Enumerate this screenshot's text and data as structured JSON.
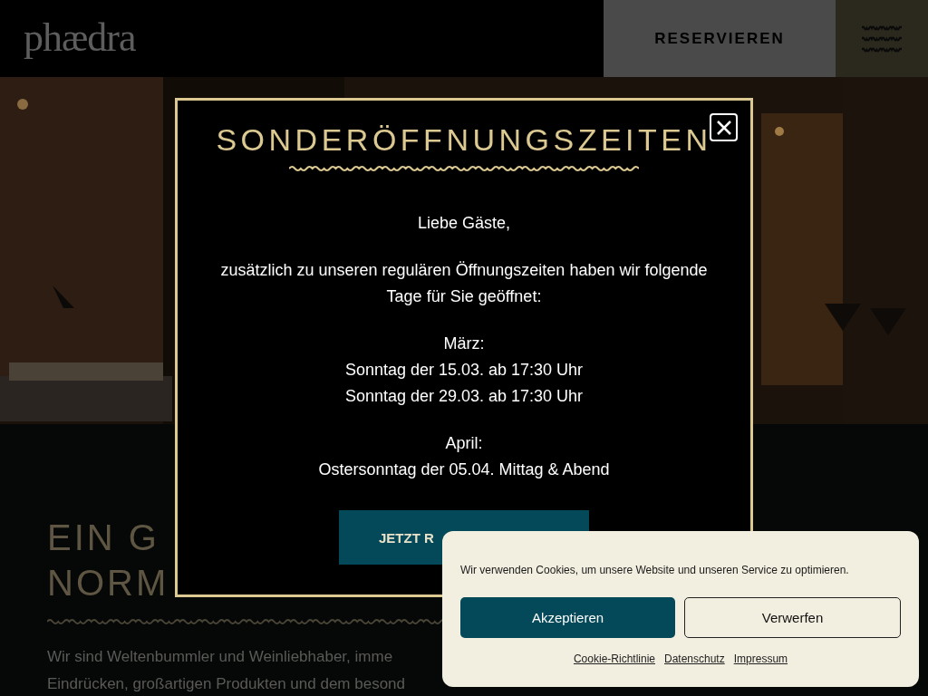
{
  "header": {
    "logo": "phædra",
    "reserve_button": "RESERVIEREN"
  },
  "intro": {
    "heading_lines": [
      "EIN G",
      "NORM"
    ],
    "paragraph_lines": [
      "Wir sind Weltenbummler und Weinliebhaber, imme",
      "Eindrücken, großartigen Produkten und dem besond"
    ]
  },
  "modal": {
    "title": "SONDERÖFFNUNGSZEITEN",
    "paragraphs": [
      [
        "Liebe Gäste,"
      ],
      [
        "zusätzlich zu unseren regulären Öffnungszeiten haben wir folgende Tage für Sie geöffnet:"
      ],
      [
        "März:",
        "Sonntag der 15.03. ab 17:30 Uhr",
        "Sonntag der 29.03. ab 17:30 Uhr"
      ],
      [
        "April:",
        "Ostersonntag der 05.04. Mittag & Abend"
      ]
    ],
    "button": "JETZT R"
  },
  "cookie_banner": {
    "message": "Wir verwenden Cookies, um unsere Website und unseren Service zu optimieren.",
    "buttons": [
      {
        "label": "Akzeptieren",
        "kind": "primary"
      },
      {
        "label": "Verwerfen",
        "kind": "secondary"
      }
    ],
    "links": [
      "Cookie-Richtlinie",
      "Datenschutz",
      "Impressum"
    ]
  }
}
